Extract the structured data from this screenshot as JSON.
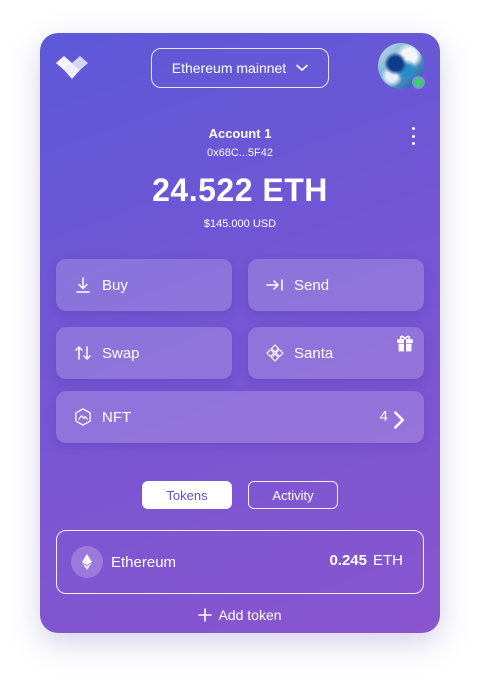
{
  "network": {
    "label": "Ethereum mainnet"
  },
  "account": {
    "name": "Account 1",
    "address": "0x68C...5F42"
  },
  "balance": {
    "eth": "24.522 ETH",
    "usd": "$145.000 USD"
  },
  "actions": {
    "buy": "Buy",
    "send": "Send",
    "swap": "Swap",
    "santa": "Santa",
    "nft": "NFT",
    "nft_count": "4"
  },
  "tabs": {
    "tokens": "Tokens",
    "activity": "Activity",
    "active": "Tokens"
  },
  "tokens": [
    {
      "name": "Ethereum",
      "amount": "0.245",
      "symbol": "ETH"
    }
  ],
  "add_token": "Add token",
  "colors": {
    "accent": "#5b52d3",
    "gradient_start": "#5d59d8",
    "gradient_end": "#8a55cf",
    "online": "#3ccf6a"
  },
  "icons": [
    "wallet-logo-icon",
    "chevron-down-icon",
    "kebab-menu-icon",
    "download-arrow-icon",
    "send-arrow-icon",
    "swap-arrows-icon",
    "santa-diamond-icon",
    "gift-icon",
    "nft-icon",
    "chevron-right-icon",
    "ethereum-icon",
    "plus-icon"
  ]
}
